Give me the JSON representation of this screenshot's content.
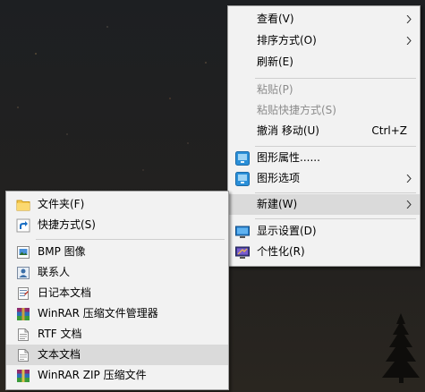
{
  "context_menu": {
    "items": [
      {
        "label": "查看(V)"
      },
      {
        "label": "排序方式(O)"
      },
      {
        "label": "刷新(E)"
      },
      {
        "label": "粘贴(P)"
      },
      {
        "label": "粘贴快捷方式(S)"
      },
      {
        "label": "撤消 移动(U)",
        "shortcut": "Ctrl+Z"
      },
      {
        "label": "图形属性......",
        "icon": "graphics-properties-icon"
      },
      {
        "label": "图形选项",
        "icon": "graphics-options-icon"
      },
      {
        "label": "新建(W)"
      },
      {
        "label": "显示设置(D)",
        "icon": "display-settings-icon"
      },
      {
        "label": "个性化(R)",
        "icon": "personalize-icon"
      }
    ]
  },
  "new_submenu": {
    "items": [
      {
        "label": "文件夹(F)",
        "icon": "folder-icon"
      },
      {
        "label": "快捷方式(S)",
        "icon": "shortcut-icon"
      },
      {
        "label": "BMP 图像",
        "icon": "bmp-image-icon"
      },
      {
        "label": "联系人",
        "icon": "contact-icon"
      },
      {
        "label": "日记本文档",
        "icon": "journal-document-icon"
      },
      {
        "label": "WinRAR 压缩文件管理器",
        "icon": "winrar-archive-icon"
      },
      {
        "label": "RTF 文档",
        "icon": "rtf-document-icon"
      },
      {
        "label": "文本文档",
        "icon": "text-document-icon"
      },
      {
        "label": "WinRAR ZIP 压缩文件",
        "icon": "winrar-zip-icon"
      }
    ]
  },
  "colors": {
    "menu_background": "#f2f2f2",
    "highlight": "#dadada",
    "disabled_text": "#8c8c8c",
    "separator": "#cfcfcf"
  }
}
